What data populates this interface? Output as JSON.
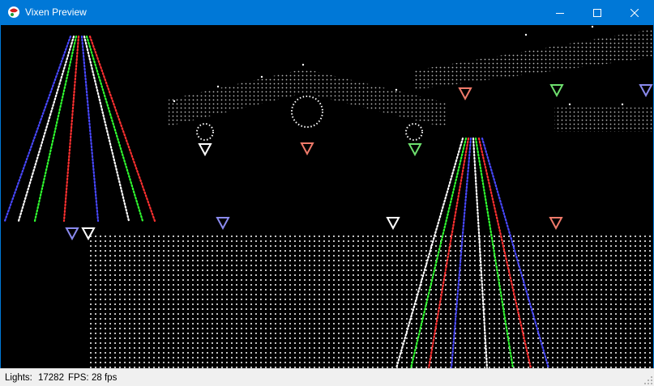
{
  "window": {
    "title": "Vixen Preview",
    "icon": "vixen-app-icon",
    "controls": [
      "minimize-icon",
      "maximize-icon",
      "close-icon"
    ]
  },
  "status": {
    "lights_label": "Lights:",
    "lights_value": "17282",
    "fps_label": "FPS:",
    "fps_value": "28 fps"
  },
  "colors": {
    "titlebar": "#0078d7",
    "canvas": "#000000",
    "statusbar": "#f0f0f0",
    "light_white": "#ffffff",
    "light_red": "#ff3030",
    "light_green": "#30ff30",
    "light_blue": "#4848ff",
    "marker_white": "#ffffff",
    "marker_salmon": "#f07a6a",
    "marker_green": "#6ee06e",
    "marker_blue": "#8a8aee"
  }
}
